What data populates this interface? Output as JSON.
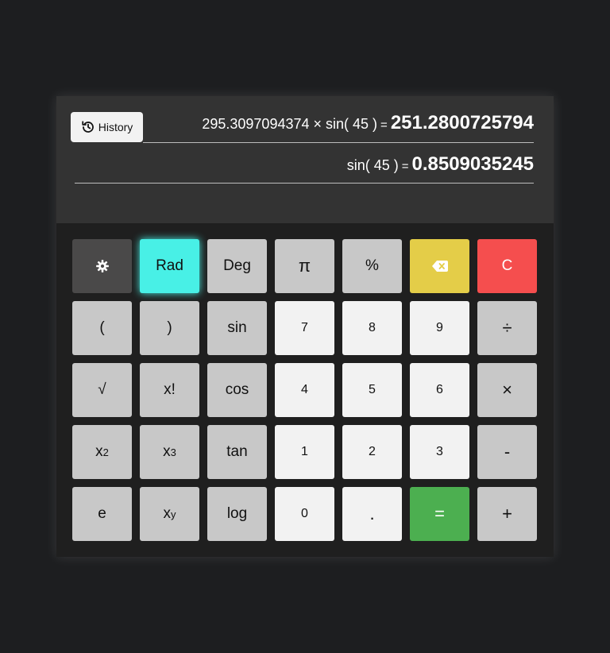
{
  "history_button": {
    "label": "History",
    "icon": "history-icon"
  },
  "display": {
    "lines": [
      {
        "expression": "295.3097094374 × sin( 45 )",
        "equals": "=",
        "result": "251.2800725794"
      },
      {
        "expression": "sin( 45 )",
        "equals": "=",
        "result": "0.8509035245"
      }
    ]
  },
  "keys": {
    "settings": {
      "icon": "gear-icon"
    },
    "rad": "Rad",
    "deg": "Deg",
    "pi": "π",
    "percent": "%",
    "backspace": {
      "icon": "backspace-icon"
    },
    "clear": "C",
    "open_paren": "(",
    "close_paren": ")",
    "sin": "sin",
    "seven": "7",
    "eight": "8",
    "nine": "9",
    "divide": "÷",
    "sqrt": "√",
    "factorial": "x!",
    "cos": "cos",
    "four": "4",
    "five": "5",
    "six": "6",
    "multiply": "×",
    "square": {
      "base": "x",
      "exp": "2"
    },
    "cube": {
      "base": "x",
      "exp": "3"
    },
    "tan": "tan",
    "one": "1",
    "two": "2",
    "three": "3",
    "subtract": "-",
    "e": "e",
    "power": {
      "base": "x",
      "exp": "y"
    },
    "log": "log",
    "zero": "0",
    "decimal": ".",
    "equals": "=",
    "add": "+"
  },
  "colors": {
    "background": "#1d1e20",
    "display": "#333333",
    "function_key": "#c8c8c8",
    "number_key": "#f2f2f2",
    "active_mode": "#48f0e6",
    "backspace": "#e4cd48",
    "clear": "#f54e4e",
    "equals": "#4caf50"
  }
}
